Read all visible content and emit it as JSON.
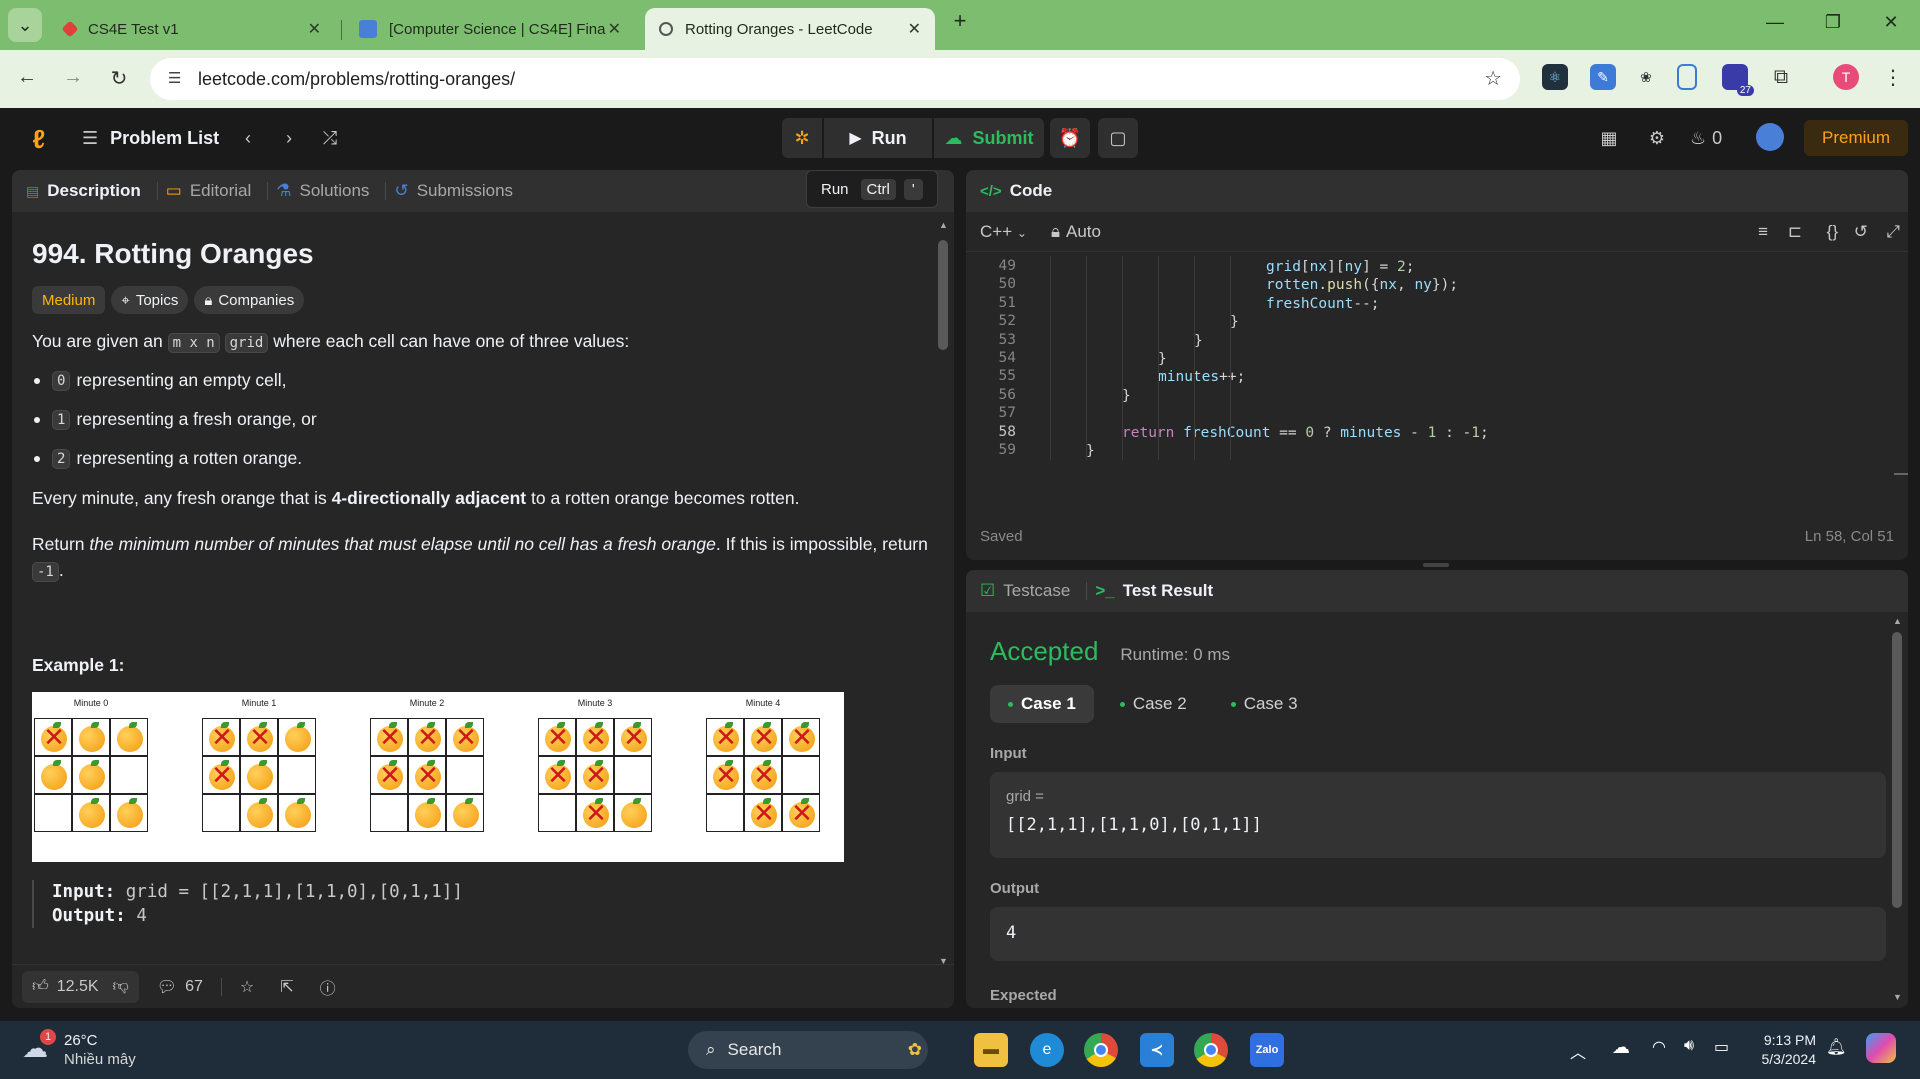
{
  "browser": {
    "tabs": [
      {
        "title": "CS4E Test v1",
        "icon_color": "#e0403a"
      },
      {
        "title": "[Computer Science | CS4E] Fina",
        "icon_color": "#4a7fd8"
      },
      {
        "title": "Rotting Oranges - LeetCode",
        "icon_color": "#d0d0d0"
      }
    ],
    "url": "leetcode.com/problems/rotting-oranges/",
    "profile_initial": "T",
    "ext_badge": "27"
  },
  "header": {
    "problem_list": "Problem List",
    "run": "Run",
    "submit": "Submit",
    "streak": "0",
    "premium": "Premium"
  },
  "tooltip": {
    "label": "Run",
    "key1": "Ctrl",
    "key2": "'"
  },
  "left_tabs": {
    "description": "Description",
    "editorial": "Editorial",
    "solutions": "Solutions",
    "submissions": "Submissions"
  },
  "problem": {
    "title": "994. Rotting Oranges",
    "difficulty": "Medium",
    "topics": "Topics",
    "companies": "Companies",
    "intro_a": "You are given an",
    "code_mxn": "m x n",
    "code_grid": "grid",
    "intro_b": "where each cell can have one of three values:",
    "bullets": [
      {
        "code": "0",
        "text": "representing an empty cell,"
      },
      {
        "code": "1",
        "text": "representing a fresh orange, or"
      },
      {
        "code": "2",
        "text": "representing a rotten orange."
      }
    ],
    "every_a": "Every minute, any fresh orange that is",
    "every_bold": "4-directionally adjacent",
    "every_b": "to a rotten orange becomes rotten.",
    "return_a": "Return",
    "return_italic": "the minimum number of minutes that must elapse until no cell has a fresh orange",
    "return_b": ". If this is impossible, return",
    "return_code": "-1",
    "return_end": ".",
    "example_title": "Example 1:",
    "minutes": [
      "Minute 0",
      "Minute 1",
      "Minute 2",
      "Minute 3",
      "Minute 4"
    ],
    "grids": [
      [
        "R",
        "F",
        "F",
        "F",
        "F",
        "E",
        "E",
        "F",
        "F"
      ],
      [
        "R",
        "R",
        "F",
        "R",
        "F",
        "E",
        "E",
        "F",
        "F"
      ],
      [
        "R",
        "R",
        "R",
        "R",
        "R",
        "E",
        "E",
        "F",
        "F"
      ],
      [
        "R",
        "R",
        "R",
        "R",
        "R",
        "E",
        "E",
        "R",
        "F"
      ],
      [
        "R",
        "R",
        "R",
        "R",
        "R",
        "E",
        "E",
        "R",
        "R"
      ]
    ],
    "input_label": "Input:",
    "input_value": "grid = [[2,1,1],[1,1,0],[0,1,1]]",
    "output_label": "Output:",
    "output_value": "4"
  },
  "footer_left": {
    "likes": "12.5K",
    "comments": "67"
  },
  "code_panel": {
    "title": "Code",
    "language": "C++",
    "mode": "Auto",
    "status": "Saved",
    "cursor": "Ln 58, Col 51",
    "lines": [
      {
        "n": "49",
        "indent": 6,
        "text": "grid[nx][ny] = 2;"
      },
      {
        "n": "50",
        "indent": 6,
        "text": "rotten.push({nx, ny});"
      },
      {
        "n": "51",
        "indent": 6,
        "text": "freshCount--;"
      },
      {
        "n": "52",
        "indent": 5,
        "text": "}"
      },
      {
        "n": "53",
        "indent": 4,
        "text": "}"
      },
      {
        "n": "54",
        "indent": 3,
        "text": "}"
      },
      {
        "n": "55",
        "indent": 3,
        "text": "minutes++;"
      },
      {
        "n": "56",
        "indent": 2,
        "text": "}"
      },
      {
        "n": "57",
        "indent": 0,
        "text": ""
      },
      {
        "n": "58",
        "indent": 2,
        "text": "return freshCount == 0 ? minutes - 1 : -1;"
      },
      {
        "n": "59",
        "indent": 1,
        "text": "}"
      }
    ]
  },
  "result_panel": {
    "tab_testcase": "Testcase",
    "tab_result": "Test Result",
    "verdict": "Accepted",
    "runtime": "Runtime: 0 ms",
    "cases": [
      "Case 1",
      "Case 2",
      "Case 3"
    ],
    "input_label": "Input",
    "input_var": "grid =",
    "input_value": "[[2,1,1],[1,1,0],[0,1,1]]",
    "output_label": "Output",
    "output_value": "4",
    "expected_label": "Expected"
  },
  "taskbar": {
    "temp": "26°C",
    "weather": "Nhiều mây",
    "search": "Search",
    "time": "9:13 PM",
    "date": "5/3/2024"
  },
  "colors": {
    "accepted": "#2cbb5d",
    "medium": "#ffb800",
    "premium_text": "#ffa116",
    "tab_bg": "#7dbd6f"
  }
}
